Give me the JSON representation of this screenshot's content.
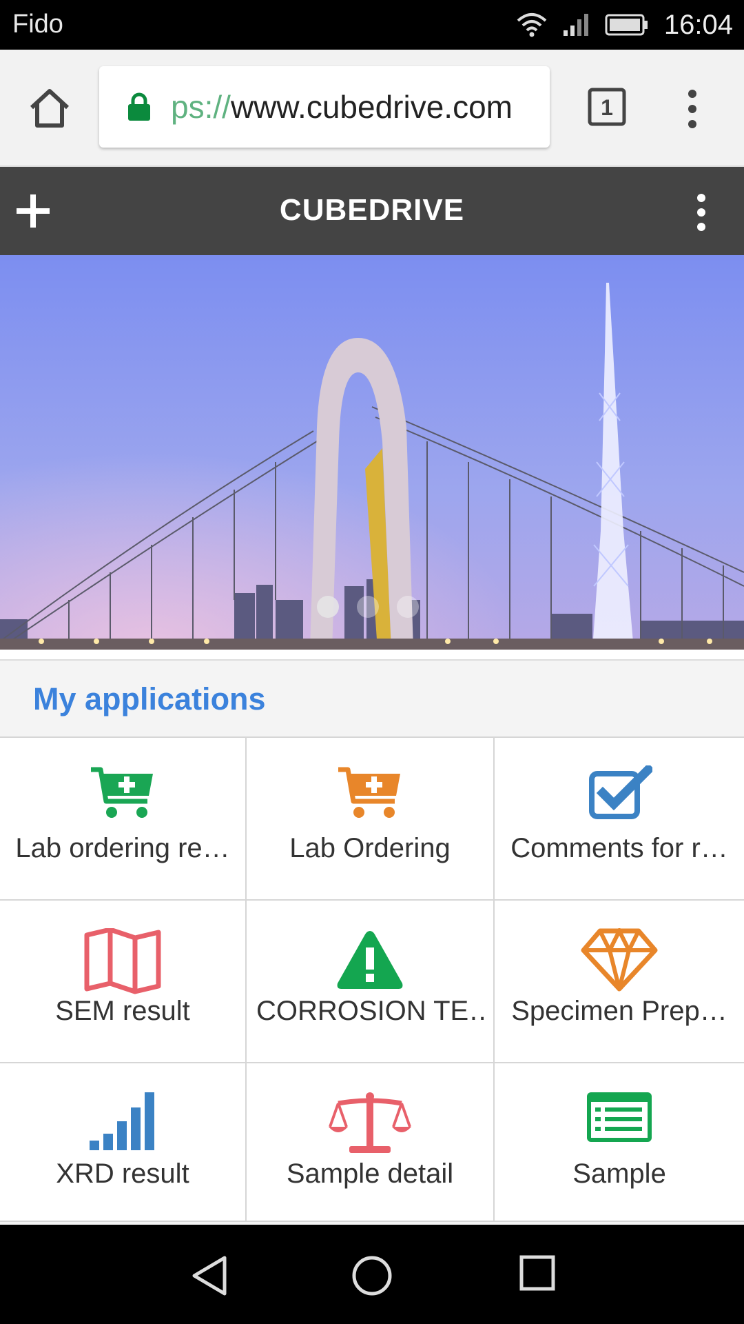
{
  "status_bar": {
    "carrier": "Fido",
    "time": "16:04"
  },
  "browser": {
    "url_scheme": "ps://",
    "url_host": "www.cubedrive.com",
    "tab_count": "1",
    "secure": true
  },
  "app": {
    "title": "CUBEDRIVE"
  },
  "banner": {
    "slide_count": 3,
    "active_slide": 1
  },
  "section": {
    "title": "My applications"
  },
  "apps": [
    {
      "label": "Lab ordering re…",
      "icon": "cart-plus-icon",
      "color": "#1aa654"
    },
    {
      "label": "Lab Ordering",
      "icon": "cart-plus-icon",
      "color": "#e8862a"
    },
    {
      "label": "Comments for r…",
      "icon": "checkbox-icon",
      "color": "#3b82c4"
    },
    {
      "label": "SEM result",
      "icon": "map-icon",
      "color": "#e8606a"
    },
    {
      "label": "CORROSION TE…",
      "icon": "warning-icon",
      "color": "#14a650"
    },
    {
      "label": "Specimen Prep…",
      "icon": "diamond-icon",
      "color": "#e8862a"
    },
    {
      "label": "XRD result",
      "icon": "signal-bars-icon",
      "color": "#3b82c4"
    },
    {
      "label": "Sample detail",
      "icon": "balance-scale-icon",
      "color": "#e8606a"
    },
    {
      "label": "Sample",
      "icon": "list-card-icon",
      "color": "#14a650"
    }
  ]
}
